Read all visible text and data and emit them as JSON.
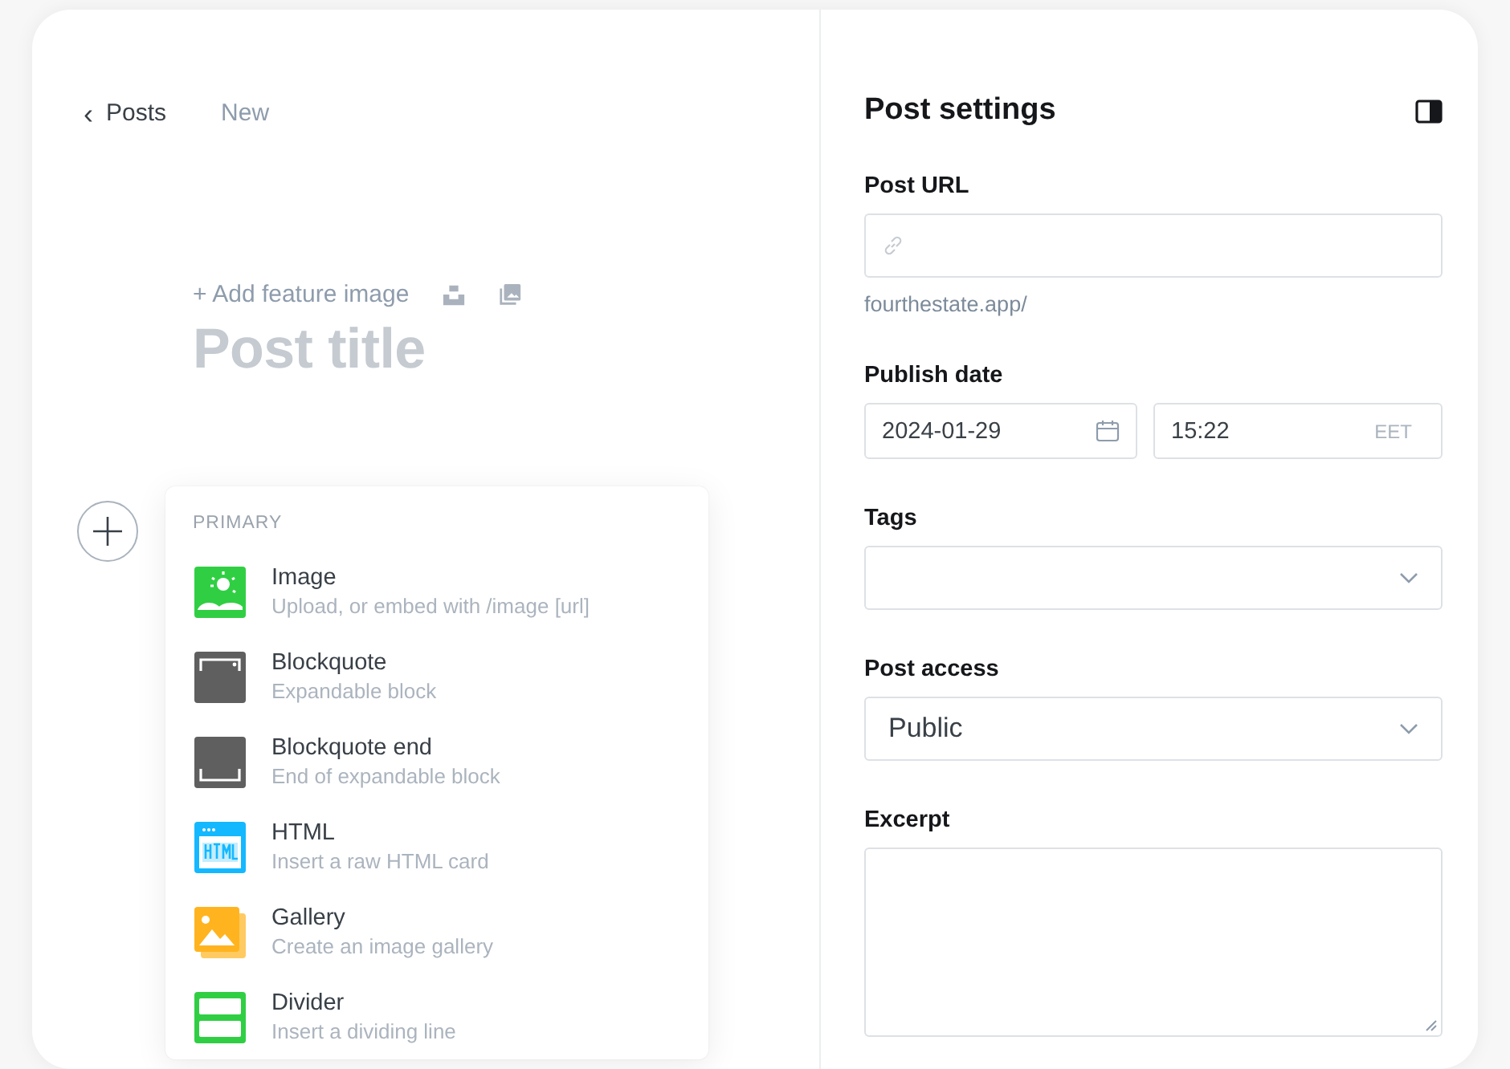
{
  "breadcrumb": {
    "back": "‹",
    "parent": "Posts",
    "current": "New"
  },
  "editor": {
    "add_feature_image": "+ Add feature image",
    "title_placeholder": "Post title"
  },
  "card_menu": {
    "section": "PRIMARY",
    "items": [
      {
        "kind": "image",
        "title": "Image",
        "description": "Upload, or embed with /image [url]"
      },
      {
        "kind": "blockquote",
        "title": "Blockquote",
        "description": "Expandable block"
      },
      {
        "kind": "blockquote-end",
        "title": "Blockquote end",
        "description": "End of expandable block"
      },
      {
        "kind": "html",
        "title": "HTML",
        "description": "Insert a raw HTML card"
      },
      {
        "kind": "gallery",
        "title": "Gallery",
        "description": "Create an image gallery"
      },
      {
        "kind": "divider",
        "title": "Divider",
        "description": "Insert a dividing line"
      }
    ]
  },
  "settings": {
    "title": "Post settings",
    "post_url": {
      "label": "Post URL",
      "hint": "fourthestate.app/"
    },
    "publish_date": {
      "label": "Publish date",
      "date": "2024-01-29",
      "time": "15:22",
      "timezone": "EET"
    },
    "tags": {
      "label": "Tags"
    },
    "post_access": {
      "label": "Post access",
      "value": "Public"
    },
    "excerpt": {
      "label": "Excerpt"
    }
  }
}
